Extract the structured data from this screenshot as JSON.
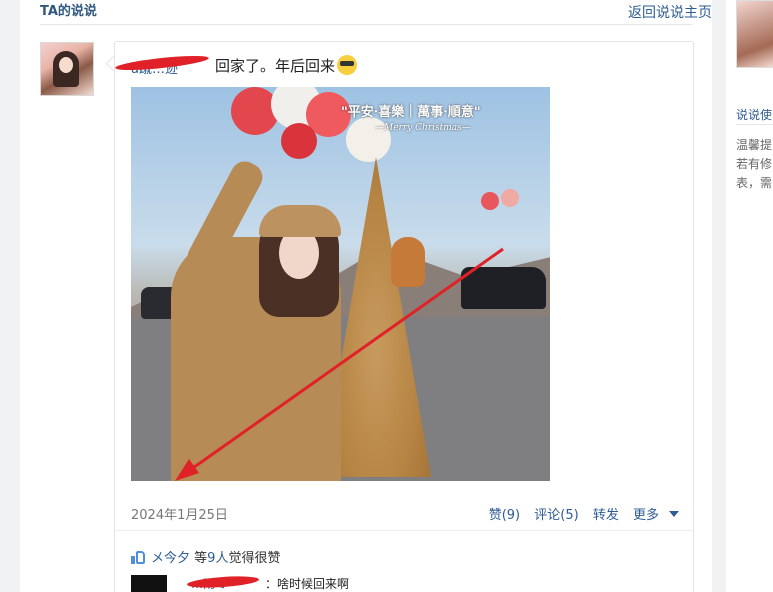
{
  "header": {
    "title": "TA的说说",
    "back_link": "返回说说主页"
  },
  "post": {
    "user_name": "a蹴…迹",
    "text": "回家了。年后回来",
    "emoji": "sunglasses-emoji",
    "photo": {
      "overlay_title": "\"平安·喜樂｜萬事·順意\"",
      "overlay_subtitle": "—Merry Christmas—"
    },
    "date": "2024年1月25日",
    "actions": {
      "like": "赞(9)",
      "comment": "评论(5)",
      "share": "转发",
      "more": "更多"
    },
    "likes": {
      "first_liker": "メ今夕",
      "suffix_pre": "等",
      "count_text": "9人",
      "suffix_post": "觉得很赞"
    },
    "comments": [
      {
        "name": "…雨ミ",
        "text": "：啥时候回来啊"
      }
    ]
  },
  "side": {
    "heading": "说说使",
    "lines": [
      "温馨提",
      "若有修",
      "表，需"
    ]
  },
  "colors": {
    "link": "#2e5c93",
    "annotation_red": "#e02228",
    "like_icon": "#4e8fd7"
  }
}
